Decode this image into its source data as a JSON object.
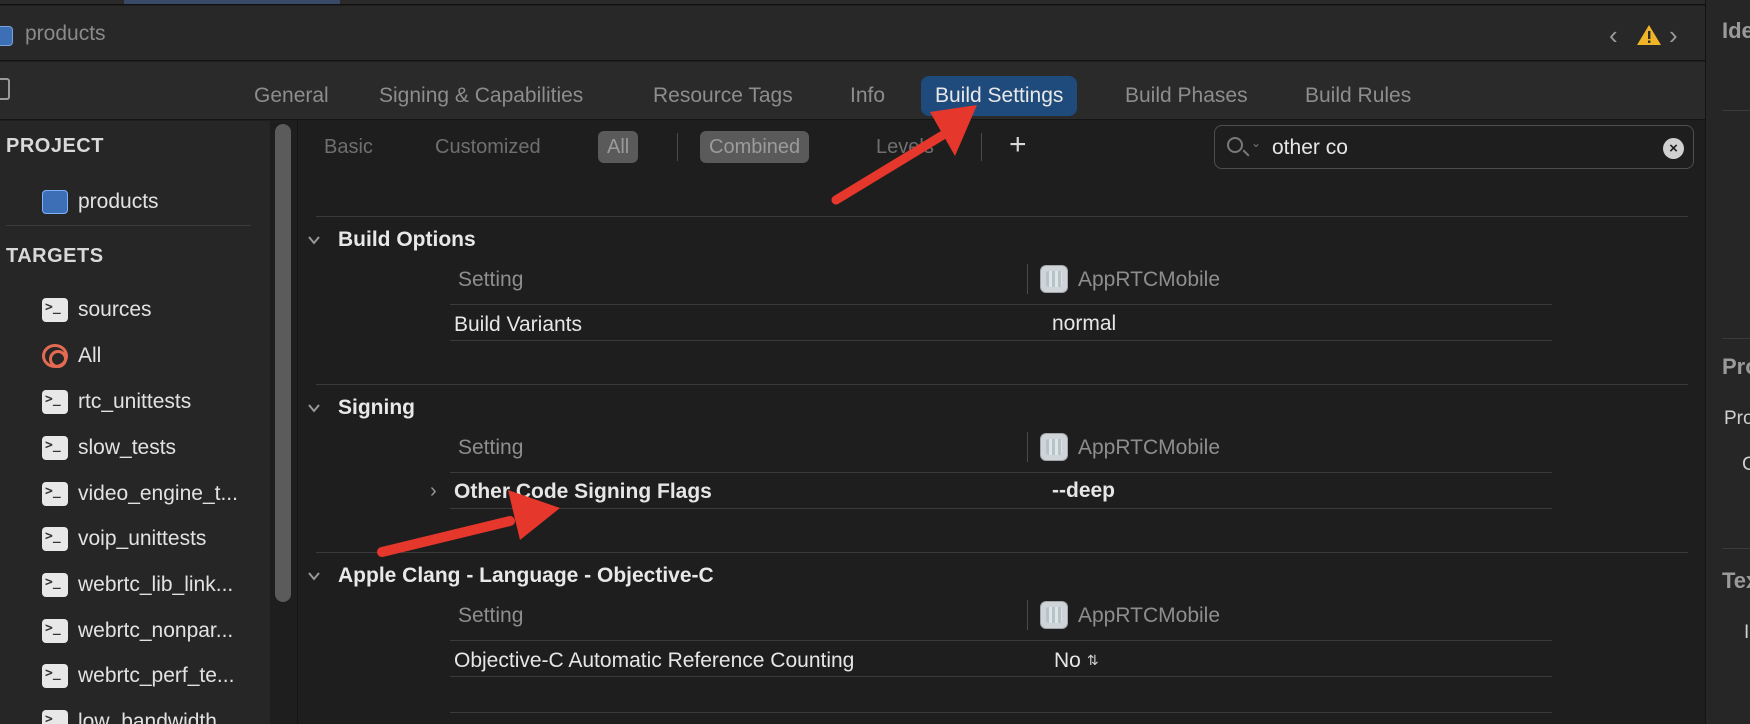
{
  "window": {
    "title": "products"
  },
  "tabs": [
    {
      "label": "General",
      "active": false
    },
    {
      "label": "Signing & Capabilities",
      "active": false
    },
    {
      "label": "Resource Tags",
      "active": false
    },
    {
      "label": "Info",
      "active": false
    },
    {
      "label": "Build Settings",
      "active": true
    },
    {
      "label": "Build Phases",
      "active": false
    },
    {
      "label": "Build Rules",
      "active": false
    }
  ],
  "sidebar": {
    "project_header": "PROJECT",
    "project_item": "products",
    "targets_header": "TARGETS",
    "targets": [
      {
        "label": "sources",
        "icon": "terminal-icon"
      },
      {
        "label": "All",
        "icon": "target-icon"
      },
      {
        "label": "rtc_unittests",
        "icon": "terminal-icon"
      },
      {
        "label": "slow_tests",
        "icon": "terminal-icon"
      },
      {
        "label": "video_engine_t...",
        "icon": "terminal-icon"
      },
      {
        "label": "voip_unittests",
        "icon": "terminal-icon"
      },
      {
        "label": "webrtc_lib_link...",
        "icon": "terminal-icon"
      },
      {
        "label": "webrtc_nonpar...",
        "icon": "terminal-icon"
      },
      {
        "label": "webrtc_perf_te...",
        "icon": "terminal-icon"
      },
      {
        "label": "low_bandwidth...",
        "icon": "terminal-icon"
      }
    ]
  },
  "filters": {
    "basic": "Basic",
    "customized": "Customized",
    "all": "All",
    "combined": "Combined",
    "levels": "Levels",
    "add": "+"
  },
  "search": {
    "value": "other co"
  },
  "groups": [
    {
      "title": "Build Options",
      "setting_header": "Setting",
      "target_header": "AppRTCMobile",
      "rows": [
        {
          "name": "Build Variants",
          "value": "normal"
        }
      ]
    },
    {
      "title": "Signing",
      "setting_header": "Setting",
      "target_header": "AppRTCMobile",
      "rows": [
        {
          "name": "Other Code Signing Flags",
          "value": "--deep"
        }
      ]
    },
    {
      "title": "Apple Clang - Language - Objective-C",
      "setting_header": "Setting",
      "target_header": "AppRTCMobile",
      "rows": [
        {
          "name": "Objective-C Automatic Reference Counting",
          "value": "No"
        }
      ]
    }
  ],
  "inspector": {
    "identity": "Ide",
    "project": "Pro",
    "project_sub": "Pro",
    "project_sub2": "C",
    "text": "Tex",
    "text_sub": "I"
  },
  "colors": {
    "accent": "#1f4b7c",
    "annotation_arrow": "#e5372b"
  }
}
